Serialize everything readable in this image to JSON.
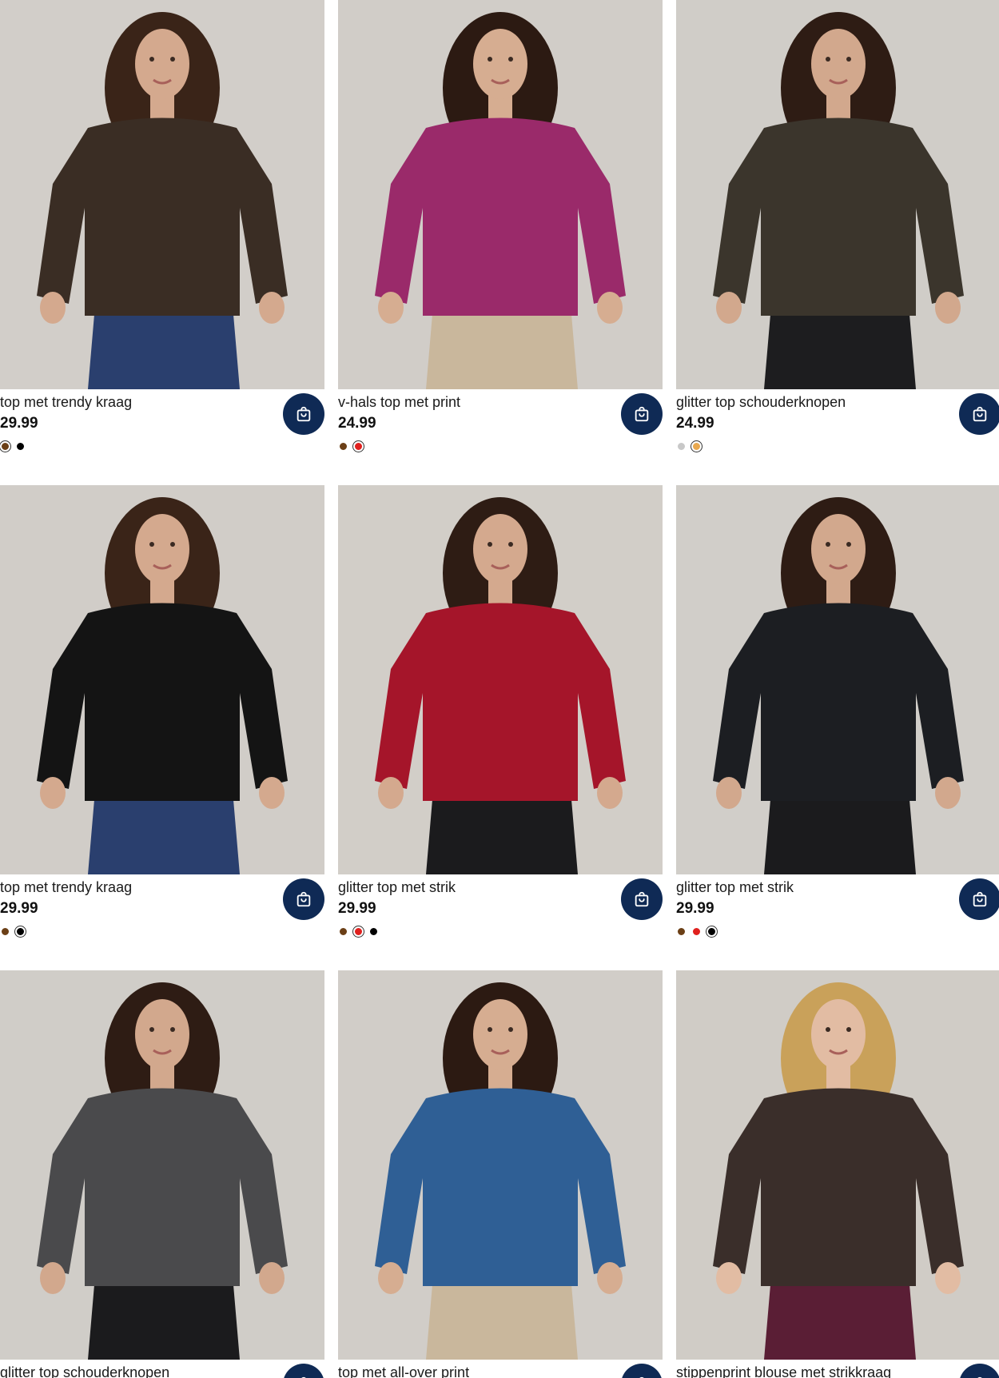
{
  "accent_color": "#0f2a55",
  "cart_icon": "shopping-bag-icon",
  "products": [
    {
      "title": "top met trendy kraag",
      "price": "29.99",
      "swatches": [
        {
          "color": "#6b3f16",
          "selected": true
        },
        {
          "color": "#000000",
          "selected": false
        }
      ],
      "bg": "#d9d5d0",
      "garment": "#3a2d24",
      "pants": "#2a3f6e",
      "hair": "#3a2418",
      "skin": "#d4a98e"
    },
    {
      "title": "v-hals top met print",
      "price": "24.99",
      "swatches": [
        {
          "color": "#6b3f16",
          "selected": false
        },
        {
          "color": "#e0201e",
          "selected": true
        }
      ],
      "bg": "#d8d4cf",
      "garment": "#9a2a6a",
      "pants": "#c9b79c",
      "hair": "#2c1a12",
      "skin": "#d6ad91"
    },
    {
      "title": "glitter top schouderknopen",
      "price": "24.99",
      "swatches": [
        {
          "color": "#c8c8c8",
          "selected": false
        },
        {
          "color": "#e8a84f",
          "selected": true
        }
      ],
      "bg": "#d7d4cf",
      "garment": "#3b352c",
      "pants": "#1d1d1f",
      "hair": "#2e1c14",
      "skin": "#d2a88d"
    },
    {
      "title": "top met trendy kraag",
      "price": "29.99",
      "swatches": [
        {
          "color": "#6b3f16",
          "selected": false
        },
        {
          "color": "#000000",
          "selected": true
        }
      ],
      "bg": "#d8d4cf",
      "garment": "#141414",
      "pants": "#2a3f6e",
      "hair": "#3a2418",
      "skin": "#d4a98e"
    },
    {
      "title": "glitter top met strik",
      "price": "29.99",
      "swatches": [
        {
          "color": "#6b3f16",
          "selected": false
        },
        {
          "color": "#e0201e",
          "selected": true
        },
        {
          "color": "#000000",
          "selected": false
        }
      ],
      "bg": "#d9d5cf",
      "garment": "#a5152a",
      "pants": "#1b1b1d",
      "hair": "#2e1c14",
      "skin": "#d4a98e"
    },
    {
      "title": "glitter top met strik",
      "price": "29.99",
      "swatches": [
        {
          "color": "#6b3f16",
          "selected": false
        },
        {
          "color": "#e0201e",
          "selected": false
        },
        {
          "color": "#000000",
          "selected": true
        }
      ],
      "bg": "#d8d5d0",
      "garment": "#1c1e22",
      "pants": "#1b1b1d",
      "hair": "#2e1c14",
      "skin": "#d2a88d"
    },
    {
      "title": "glitter top schouderknopen",
      "price": "",
      "swatches": [],
      "bg": "#d7d4cf",
      "garment": "#4a4a4c",
      "pants": "#1b1b1d",
      "hair": "#2e1c14",
      "skin": "#d2a88d"
    },
    {
      "title": "top met all-over print",
      "price": "",
      "swatches": [],
      "bg": "#d8d4cf",
      "garment": "#2f5f95",
      "pants": "#c9b79c",
      "hair": "#2c1a12",
      "skin": "#d6ad91"
    },
    {
      "title": "stippenprint blouse met strikkraag",
      "price": "",
      "swatches": [],
      "bg": "#d7d3cd",
      "garment": "#3a2e2a",
      "pants": "#5a1e35",
      "hair": "#c9a15a",
      "skin": "#e2bca3"
    }
  ]
}
